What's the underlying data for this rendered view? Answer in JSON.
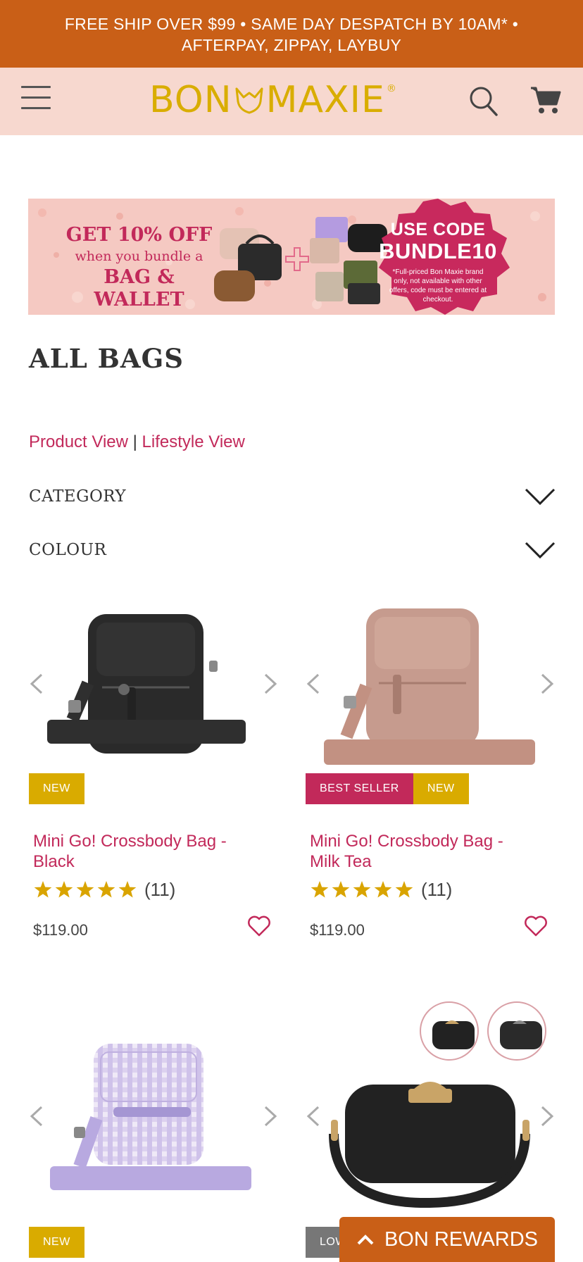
{
  "promo": {
    "line1": "FREE SHIP OVER $99 • SAME DAY DESPATCH BY 10AM* •",
    "line2": "AFTERPAY, ZIPPAY, LAYBUY"
  },
  "header": {
    "logo_left": "BON",
    "logo_right": "MAXIE",
    "logo_mark": "®",
    "menu_icon": "hamburger-icon",
    "search_icon": "search-icon",
    "cart_icon": "cart-icon"
  },
  "banner": {
    "left_line1": "GET 10% OFF",
    "left_line2": "when you bundle a",
    "left_line3": "BAG & WALLET",
    "code_line1": "USE CODE",
    "code_line2": "BUNDLE10",
    "fineprint": "*Full-priced Bon Maxie brand only, not available with other offers, code must be entered at checkout."
  },
  "page": {
    "title": "ALL BAGS",
    "view_product": "Product View",
    "view_separator": " | ",
    "view_lifestyle": "Lifestyle View"
  },
  "filters": {
    "category": "CATEGORY",
    "colour": "COLOUR"
  },
  "products": [
    {
      "name": "Mini Go! Crossbody Bag - Black",
      "tags": [
        "NEW"
      ],
      "rating": 5,
      "review_count": "(11)",
      "price": "$119.00"
    },
    {
      "name": "Mini Go! Crossbody Bag - Milk Tea",
      "tags": [
        "BEST SELLER",
        "NEW"
      ],
      "rating": 5,
      "review_count": "(11)",
      "price": "$119.00"
    },
    {
      "tags": [
        "NEW"
      ]
    },
    {
      "tags": [
        "LOW"
      ]
    }
  ],
  "rewards": {
    "label": "BON REWARDS"
  },
  "colors": {
    "promo_bg": "#c95f17",
    "header_bg": "#f7d8cf",
    "brand_gold": "#d9ad00",
    "accent_pink": "#c2295a",
    "tag_new": "#d9ab00",
    "tag_best": "#c2295a"
  }
}
